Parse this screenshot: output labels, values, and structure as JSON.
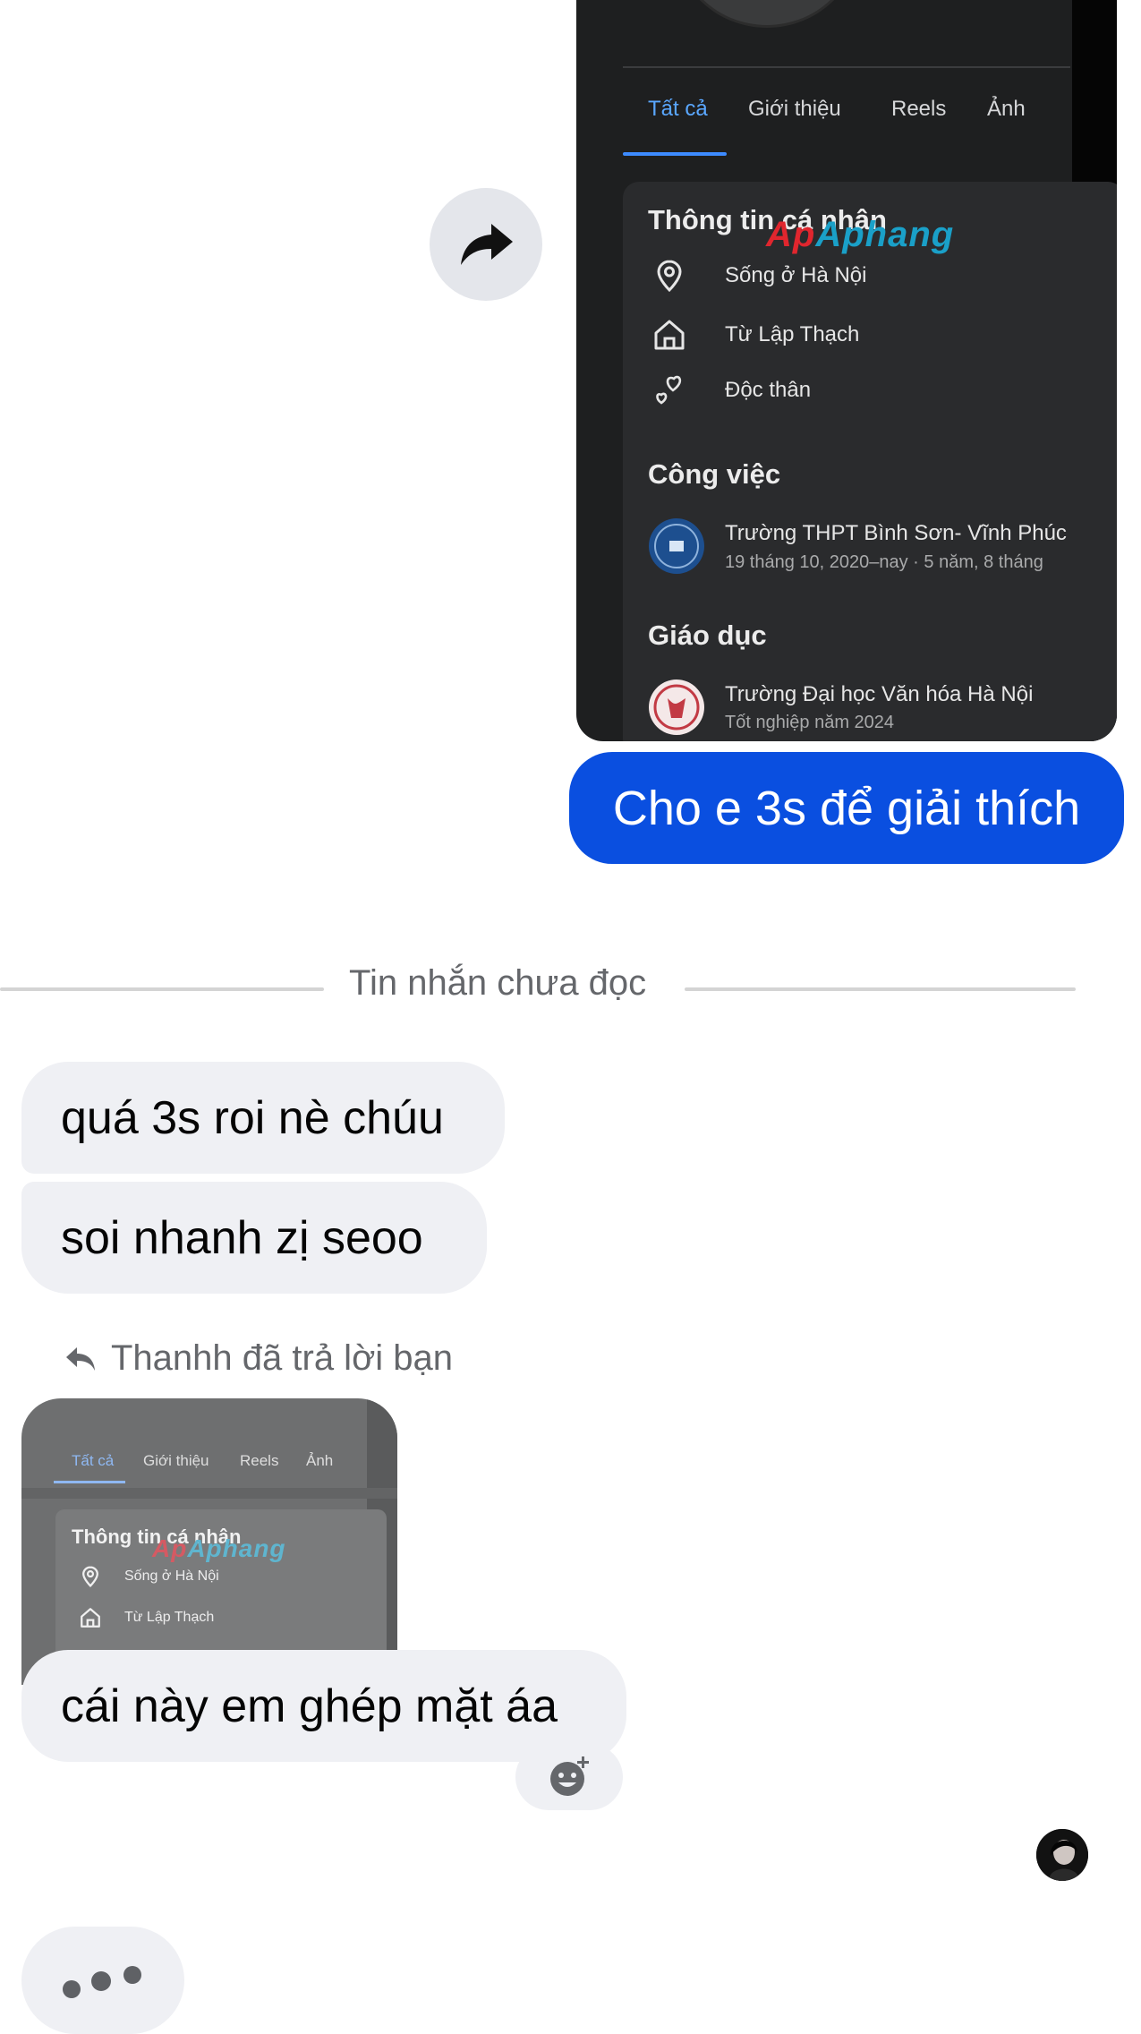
{
  "shared_screenshot": {
    "tabs": [
      "Tất cả",
      "Giới thiệu",
      "Reels",
      "Ảnh"
    ],
    "active_tab": "Tất cả",
    "watermark": "Aphang",
    "personal_info": {
      "heading": "Thông tin cá nhân",
      "rows": [
        {
          "icon": "location-pin-icon",
          "text": "Sống ở Hà Nội"
        },
        {
          "icon": "home-icon",
          "text": "Từ Lập Thạch"
        },
        {
          "icon": "hearts-icon",
          "text": "Độc thân"
        }
      ]
    },
    "work": {
      "heading": "Công việc",
      "name": "Trường THPT Bình Sơn- Vĩnh Phúc",
      "detail": "19 tháng 10, 2020–nay · 5 năm, 8 tháng"
    },
    "education": {
      "heading": "Giáo dục",
      "name": "Trường Đại học Văn hóa Hà Nội",
      "detail": "Tốt nghiệp năm 2024"
    }
  },
  "outgoing_message": "Cho e 3s để giải thích",
  "unread_divider": "Tin nhắn chưa đọc",
  "incoming_messages": [
    "quá 3s roi nè chúu",
    "soi nhanh zị seoo"
  ],
  "reply_info": "Thanhh đã trả lời bạn",
  "replied_preview": {
    "tabs": [
      "Tất cả",
      "Giới thiệu",
      "Reels",
      "Ảnh"
    ],
    "heading": "Thông tin cá nhân",
    "watermark": "Aphang",
    "rows": [
      "Sống ở Hà Nội",
      "Từ Lập Thạch"
    ]
  },
  "reply_message": "cái này em ghép mặt áa",
  "colors": {
    "outgoing_bubble": "#0a4fe0",
    "incoming_bubble": "#eff0f4",
    "active_tab": "#5aa7ff"
  },
  "icons": {
    "forward": "forward-arrow-icon",
    "reply": "reply-arrow-icon",
    "react": "add-reaction-icon",
    "typing": "typing-indicator"
  }
}
